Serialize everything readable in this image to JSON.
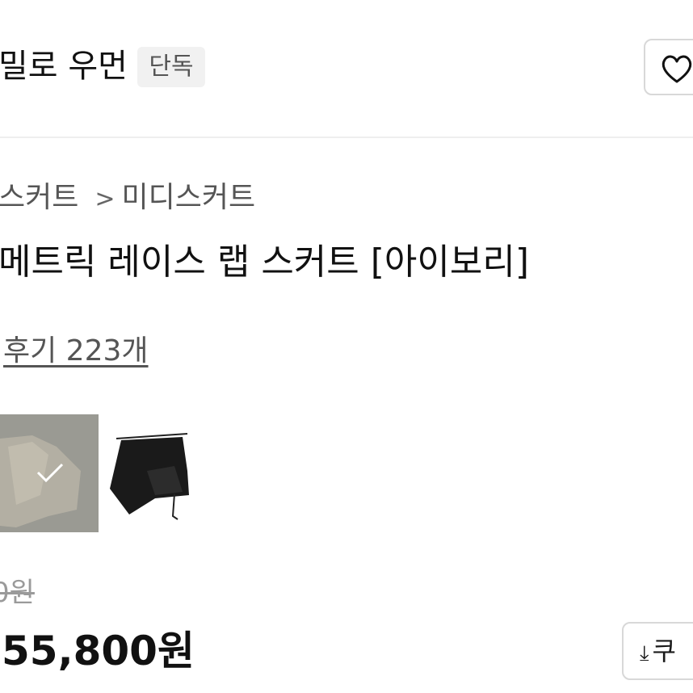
{
  "header": {
    "brand_name": "밀로 우먼",
    "exclusive_badge": "단독",
    "wish_icon": "heart-outline-icon"
  },
  "breadcrumb": {
    "parent": "스커트",
    "separator": ">",
    "current": "미디스커트"
  },
  "product": {
    "title": "메트릭 레이스 랩 스커트 [아이보리]",
    "reviews_label": "후기 223개"
  },
  "color_options": [
    {
      "name": "ivory",
      "selected": true
    },
    {
      "name": "black",
      "selected": false
    }
  ],
  "pricing": {
    "original_price": "0원",
    "sale_price": "55,800원",
    "coupon_icon": "download-icon",
    "coupon_label": "쿠"
  }
}
